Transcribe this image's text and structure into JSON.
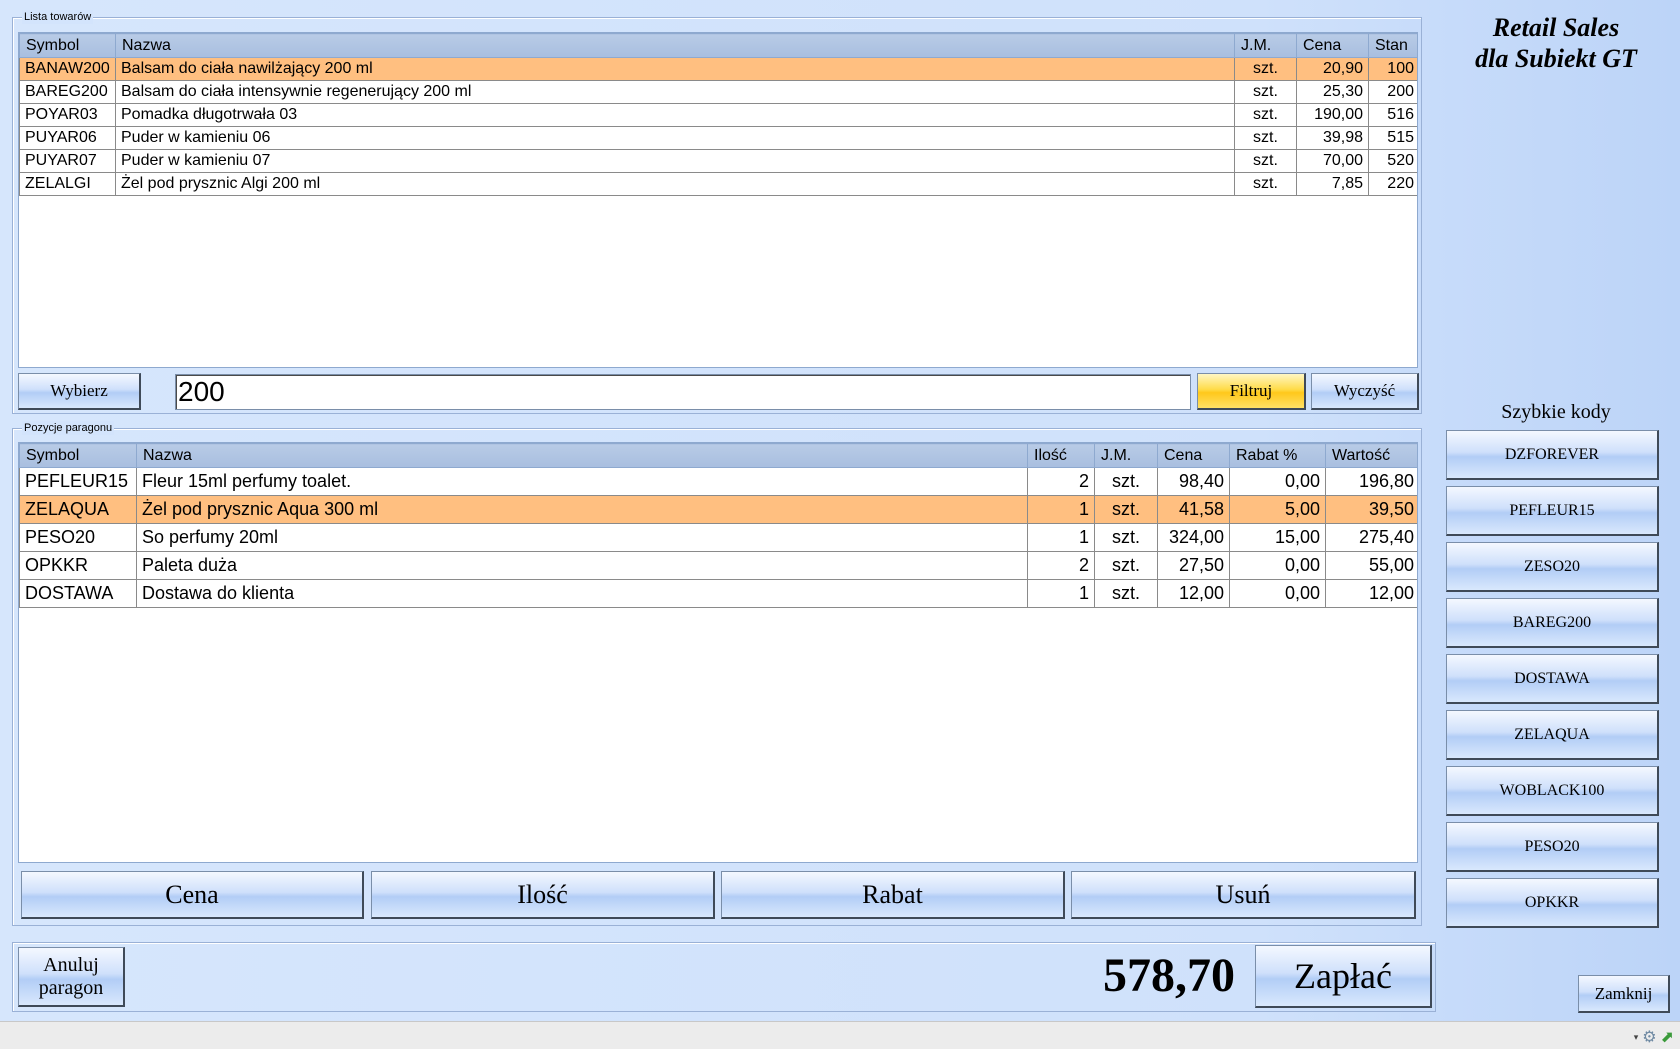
{
  "app_title": {
    "line1": "Retail Sales",
    "line2": "dla Subiekt GT"
  },
  "products_group": {
    "legend": "Lista towarów",
    "columns": [
      "Symbol",
      "Nazwa",
      "J.M.",
      "Cena",
      "Stan"
    ],
    "rows": [
      {
        "symbol": "BANAW200",
        "name": "Balsam do ciała nawilżający 200 ml",
        "unit": "szt.",
        "price": "20,90",
        "stock": "100",
        "selected": true
      },
      {
        "symbol": "BAREG200",
        "name": "Balsam do ciała intensywnie regenerujący 200 ml",
        "unit": "szt.",
        "price": "25,30",
        "stock": "200",
        "selected": false
      },
      {
        "symbol": "POYAR03",
        "name": "Pomadka długotrwała 03",
        "unit": "szt.",
        "price": "190,00",
        "stock": "516",
        "selected": false
      },
      {
        "symbol": "PUYAR06",
        "name": "Puder w kamieniu 06",
        "unit": "szt.",
        "price": "39,98",
        "stock": "515",
        "selected": false
      },
      {
        "symbol": "PUYAR07",
        "name": "Puder w kamieniu 07",
        "unit": "szt.",
        "price": "70,00",
        "stock": "520",
        "selected": false
      },
      {
        "symbol": "ZELALGI",
        "name": "Żel pod prysznic Algi 200 ml",
        "unit": "szt.",
        "price": "7,85",
        "stock": "220",
        "selected": false
      }
    ],
    "select_button": "Wybierz",
    "filter_value": "200",
    "filter_button": "Filtruj",
    "clear_button": "Wyczyść"
  },
  "receipt_group": {
    "legend": "Pozycje paragonu",
    "columns": [
      "Symbol",
      "Nazwa",
      "Ilość",
      "J.M.",
      "Cena",
      "Rabat %",
      "Wartość"
    ],
    "rows": [
      {
        "symbol": "PEFLEUR15",
        "name": "Fleur 15ml perfumy toalet.",
        "qty": "2",
        "unit": "szt.",
        "price": "98,40",
        "discount": "0,00",
        "value": "196,80",
        "selected": false
      },
      {
        "symbol": "ZELAQUA",
        "name": "Żel pod prysznic Aqua 300 ml",
        "qty": "1",
        "unit": "szt.",
        "price": "41,58",
        "discount": "5,00",
        "value": "39,50",
        "selected": true
      },
      {
        "symbol": "PESO20",
        "name": "So perfumy 20ml",
        "qty": "1",
        "unit": "szt.",
        "price": "324,00",
        "discount": "15,00",
        "value": "275,40",
        "selected": false
      },
      {
        "symbol": "OPKKR",
        "name": "Paleta duża",
        "qty": "2",
        "unit": "szt.",
        "price": "27,50",
        "discount": "0,00",
        "value": "55,00",
        "selected": false
      },
      {
        "symbol": "DOSTAWA",
        "name": "Dostawa do klienta",
        "qty": "1",
        "unit": "szt.",
        "price": "12,00",
        "discount": "0,00",
        "value": "12,00",
        "selected": false
      }
    ],
    "actions": {
      "price": "Cena",
      "quantity": "Ilość",
      "discount": "Rabat",
      "remove": "Usuń"
    }
  },
  "footer": {
    "cancel_line1": "Anuluj",
    "cancel_line2": "paragon",
    "total": "578,70",
    "pay_button": "Zapłać"
  },
  "quick_codes": {
    "label": "Szybkie kody",
    "items": [
      "DZFOREVER",
      "PEFLEUR15",
      "ZESO20",
      "BAREG200",
      "DOSTAWA",
      "ZELAQUA",
      "WOBLACK100",
      "PESO20",
      "OPKKR"
    ]
  },
  "close_button": "Zamknij",
  "colors": {
    "selection": "#ffbf80",
    "filter_accent": "#ffc81b",
    "background": "#cfe1fb"
  }
}
